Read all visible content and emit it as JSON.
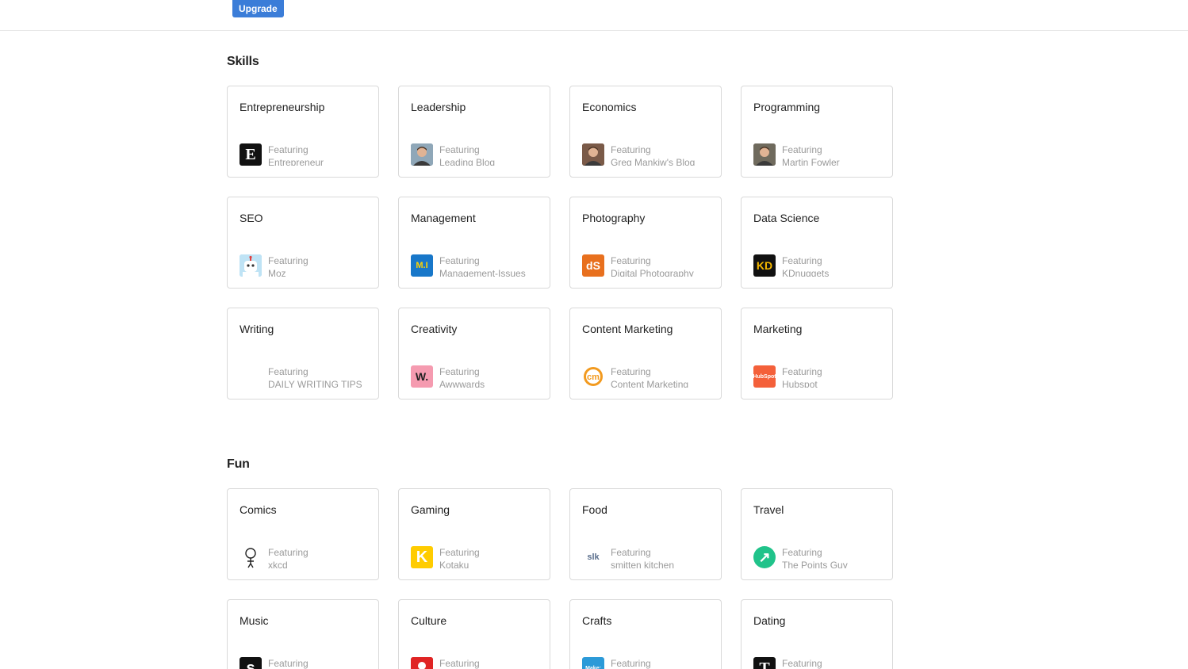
{
  "header": {
    "upgrade_label": "Upgrade"
  },
  "feature_prefix": "Featuring",
  "sections": [
    {
      "title": "Skills",
      "cards": [
        {
          "title": "Entrepreneurship",
          "source": "Entrepreneur",
          "icon": "entrepreneur-logo-icon",
          "logo_text": "E",
          "logo_bg": "#111111",
          "logo_fg": "#ffffff"
        },
        {
          "title": "Leadership",
          "source": "Leading Blog",
          "icon": "person-photo-icon",
          "logo_text": "",
          "logo_bg": "#8fa7b8",
          "logo_fg": "#ffffff"
        },
        {
          "title": "Economics",
          "source": "Greg Mankiw's Blog",
          "icon": "person-photo-icon",
          "logo_text": "",
          "logo_bg": "#7a5a48",
          "logo_fg": "#ffffff"
        },
        {
          "title": "Programming",
          "source": "Martin Fowler",
          "icon": "person-photo-icon",
          "logo_text": "",
          "logo_bg": "#6f6a5d",
          "logo_fg": "#ffffff"
        },
        {
          "title": "SEO",
          "source": "Moz",
          "icon": "moz-robot-icon",
          "logo_text": "",
          "logo_bg": "#7fc6ea",
          "logo_fg": "#ffffff"
        },
        {
          "title": "Management",
          "source": "Management-Issues",
          "icon": "management-issues-logo-icon",
          "logo_text": "M.I",
          "logo_bg": "#1877c9",
          "logo_fg": "#ffd200"
        },
        {
          "title": "Photography",
          "source": "Digital Photography",
          "icon": "dps-logo-icon",
          "logo_text": "dS",
          "logo_bg": "#e8701e",
          "logo_fg": "#ffffff"
        },
        {
          "title": "Data Science",
          "source": "KDnuggets",
          "icon": "kdnuggets-logo-icon",
          "logo_text": "KD",
          "logo_bg": "#111111",
          "logo_fg": "#f5b800"
        },
        {
          "title": "Writing",
          "source": "DAILY WRITING TIPS",
          "icon": "blank-logo-icon",
          "logo_text": "",
          "logo_bg": "#ffffff",
          "logo_fg": "#ffffff"
        },
        {
          "title": "Creativity",
          "source": "Awwwards",
          "icon": "awwwards-logo-icon",
          "logo_text": "W.",
          "logo_bg": "#f59bb0",
          "logo_fg": "#222222"
        },
        {
          "title": "Content Marketing",
          "source": "Content Marketing",
          "icon": "cmi-logo-icon",
          "logo_text": "cm",
          "logo_bg": "#f29a1f",
          "logo_fg": "#ffffff"
        },
        {
          "title": "Marketing",
          "source": "Hubspot",
          "icon": "hubspot-logo-icon",
          "logo_text": "HubSpot",
          "logo_bg": "#f4603a",
          "logo_fg": "#ffffff"
        }
      ]
    },
    {
      "title": "Fun",
      "cards": [
        {
          "title": "Comics",
          "source": "xkcd",
          "icon": "xkcd-stickfigure-icon",
          "logo_text": "",
          "logo_bg": "#ffffff",
          "logo_fg": "#222222"
        },
        {
          "title": "Gaming",
          "source": "Kotaku",
          "icon": "kotaku-logo-icon",
          "logo_text": "K",
          "logo_bg": "#ffcc00",
          "logo_fg": "#ffffff"
        },
        {
          "title": "Food",
          "source": "smitten kitchen",
          "icon": "smitten-kitchen-logo-icon",
          "logo_text": "slk",
          "logo_bg": "#ffffff",
          "logo_fg": "#5a6e8c"
        },
        {
          "title": "Travel",
          "source": "The Points Guy",
          "icon": "points-guy-arrow-icon",
          "logo_text": "↗",
          "logo_bg": "#20c38a",
          "logo_fg": "#ffffff"
        },
        {
          "title": "Music",
          "source": "",
          "icon": "music-logo-icon",
          "logo_text": "s",
          "logo_bg": "#111111",
          "logo_fg": "#ffffff"
        },
        {
          "title": "Culture",
          "source": "",
          "icon": "culture-logo-icon",
          "logo_text": "",
          "logo_bg": "#e02424",
          "logo_fg": "#ffffff"
        },
        {
          "title": "Crafts",
          "source": "",
          "icon": "make-logo-icon",
          "logo_text": "Make:",
          "logo_bg": "#2c9ad8",
          "logo_fg": "#ffffff"
        },
        {
          "title": "Dating",
          "source": "",
          "icon": "nyt-logo-icon",
          "logo_text": "T",
          "logo_bg": "#111111",
          "logo_fg": "#ffffff"
        }
      ]
    }
  ]
}
